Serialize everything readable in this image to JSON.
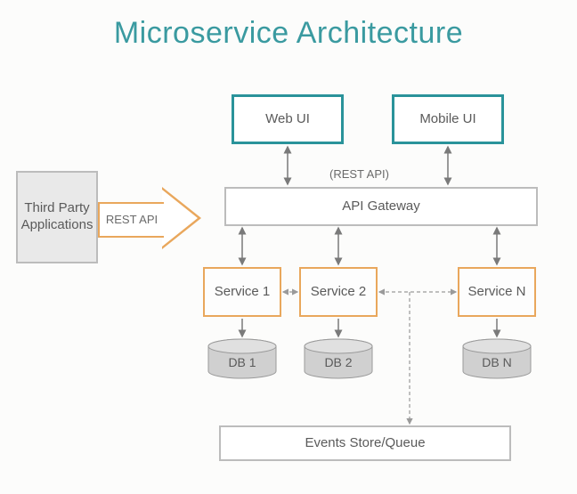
{
  "title": "Microservice Architecture",
  "third_party": "Third Party Applications",
  "rest_api_arrow": "REST API",
  "web_ui": "Web UI",
  "mobile_ui": "Mobile UI",
  "rest_api_label": "(REST API)",
  "api_gateway": "API Gateway",
  "service1": "Service 1",
  "service2": "Service 2",
  "serviceN": "Service N",
  "db1": "DB 1",
  "db2": "DB 2",
  "dbN": "DB N",
  "events": "Events Store/Queue"
}
